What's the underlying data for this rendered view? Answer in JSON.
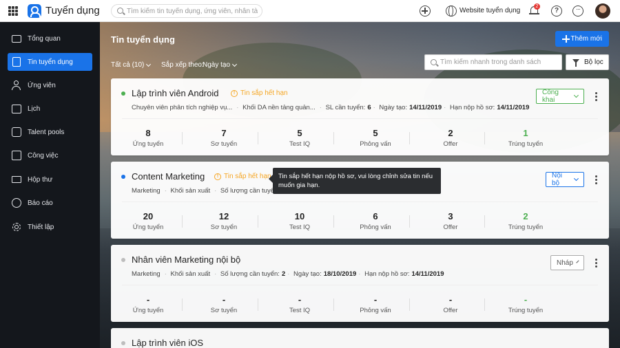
{
  "app": {
    "title": "Tuyển dụng"
  },
  "search": {
    "placeholder": "Tìm kiếm tin tuyển dụng, ứng viên, nhân tài..."
  },
  "topbar": {
    "website_label": "Website tuyển dụng",
    "notification_count": "2",
    "help_label": "?",
    "more_label": "···"
  },
  "sidebar": {
    "items": [
      {
        "label": "Tổng quan",
        "icon": "dashboard-icon"
      },
      {
        "label": "Tin tuyển dụng",
        "icon": "job-post-icon",
        "active": true
      },
      {
        "label": "Ứng viên",
        "icon": "candidates-icon"
      },
      {
        "label": "Lịch",
        "icon": "calendar-icon"
      },
      {
        "label": "Talent pools",
        "icon": "talent-pool-icon"
      },
      {
        "label": "Công việc",
        "icon": "task-icon"
      },
      {
        "label": "Hộp thư",
        "icon": "mail-icon"
      },
      {
        "label": "Báo cáo",
        "icon": "report-icon"
      },
      {
        "label": "Thiết lập",
        "icon": "settings-icon"
      }
    ]
  },
  "main": {
    "title": "Tin tuyển dụng",
    "add_label": "Thêm mới",
    "filter_all": "Tất cả (10)",
    "sort_label": "Sắp xếp theo:",
    "sort_value": "Ngày tạo",
    "quick_search_placeholder": "Tìm kiếm nhanh trong danh sách",
    "filter_label": "Bộ lọc"
  },
  "jobs": [
    {
      "title": "Lập trình viên Android",
      "dot_color": "#4caf50",
      "warning": "Tin sắp hết hạn",
      "status": "Công khai",
      "status_color": "#4caf50",
      "meta": {
        "position": "Chuyên viên phân tích nghiệp vụ...",
        "department": "Khối DA nền tảng quản...",
        "quantity_label": "SL cần tuyển:",
        "quantity": "6",
        "created_label": "Ngày tạo:",
        "created": "14/11/2019",
        "deadline_label": "Hạn nộp hồ sơ:",
        "deadline": "14/11/2019"
      },
      "stats": [
        "8",
        "7",
        "5",
        "5",
        "2",
        "1"
      ]
    },
    {
      "title": "Content Marketing",
      "dot_color": "#1a73e8",
      "warning": "Tin sắp hết hạn",
      "status": "Nội bộ",
      "status_color": "#1a73e8",
      "meta": {
        "position": "Marketing",
        "department": "Khối sản xuất",
        "quantity_label": "Số lượng cần tuyển",
        "quantity": "",
        "created_label": "",
        "created": "",
        "deadline_label": "",
        "deadline": ""
      },
      "stats": [
        "20",
        "12",
        "10",
        "6",
        "3",
        "2"
      ]
    },
    {
      "title": "Nhân viên Marketing nội bộ",
      "dot_color": "#bdbdbd",
      "warning": "",
      "status": "Nháp",
      "status_color": "#555555",
      "meta": {
        "position": "Marketing",
        "department": "Khối sản xuất",
        "quantity_label": "Số lượng cần tuyển:",
        "quantity": "2",
        "created_label": "Ngày tạo:",
        "created": "18/10/2019",
        "deadline_label": "Hạn nộp hồ sơ:",
        "deadline": "14/11/2019"
      },
      "stats": [
        "-",
        "-",
        "-",
        "-",
        "-",
        "-"
      ]
    },
    {
      "title": "Lập trình viên iOS",
      "dot_color": "#bdbdbd"
    }
  ],
  "stat_labels": [
    "Ứng tuyển",
    "Sơ tuyển",
    "Test IQ",
    "Phỏng vấn",
    "Offer",
    "Trúng tuyển"
  ],
  "tooltip": {
    "text": "Tin sắp hết hạn nộp hồ sơ, vui lòng chỉnh sửa tin nếu muốn gia hạn."
  }
}
